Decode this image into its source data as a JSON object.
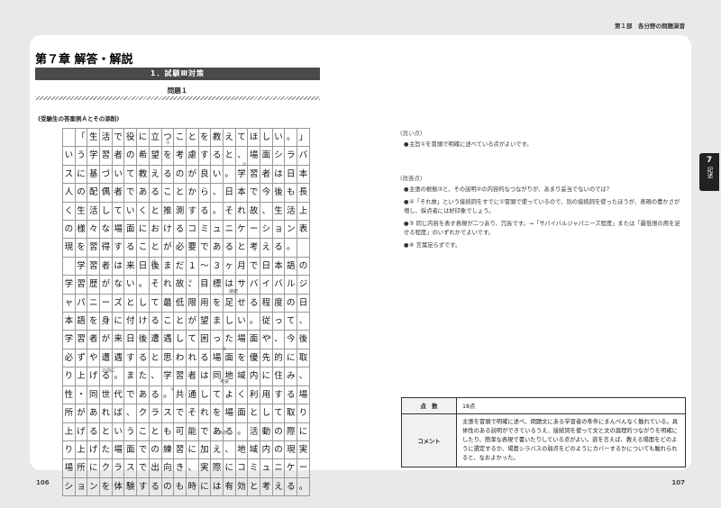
{
  "running_head": "第１部　各分野の問題演習",
  "left_page": {
    "chapter_title": "第７章 解答・解説",
    "section_bar": "1．試験Ⅲ対策",
    "question_title": "問題１",
    "sample_title": "(受験生の答案例Ａとその添削)",
    "grid_rows": [
      " 「生活で役に立つことを教えてほしい。」と",
      "いう学習者の希望を考慮すると、場面シラバ",
      "スに基づいて教えるのが良い。学習者は日本",
      "人の配偶者であることから、日本で今後も長",
      "く生活していくと推測する。それ故、生活上",
      "の様々な場面におけるコミュニケーション表",
      "現を習得することが必要であると考える。",
      " 学習者は来日後まだ１〜３ヶ月で日本語の",
      "学習歴がない。それ故、目標はサバイバルジ",
      "ャパニーズとして最低限用を足せる程度の日",
      "本語を身に付けることが望ましい。従って、",
      "学習者が来日後遭遇して困った場面や、今後",
      "必ずや遭遇すると思われる場面を優先的に取",
      "り上げる。また、学習者は同地域内に住み、同",
      "性・同世代である。共通してよく利用する場",
      "所があれば、クラスでそれを場面として取り",
      "上げるということも可能である。活動の際に取",
      "り上げた場面での練習に加え、地域内の現実の",
      "場所にクラスで出向き、実際にコミュニケー",
      "ションを体験するのも時には有効と考える。"
    ],
    "corrections": [
      "①",
      "②",
      "③",
      "④",
      "接続",
      "⑤",
      "の前に",
      "⑥",
      "考慮",
      "⑦",
      "である"
    ],
    "page_number": "106"
  },
  "right_page": {
    "good_heading": "(良い点)",
    "good_points": [
      "主旨①を冒頭で明確に述べている点がよいです。"
    ],
    "improve_heading": "(改善点)",
    "improve_points": [
      "主張の根拠③と、その説明②の内容的なつながりが、あまり妥当でないのでは？",
      "④「それ故」という接続詞をすでに①冒頭で使っているので、別の接続詞を使ったほうが、表現の豊かさが増し、採点者には好印象でしょう。",
      "⑤ 同じ内容を表す表現が二つあり、冗長です。→「サバイバルジャパニーズ程度」または「最低限の用を足せる程度」のいずれかでよいです。",
      "⑥ 言葉足らずです。"
    ],
    "score_label": "点　数",
    "score_value": "18点",
    "comment_label": "コメント",
    "comment_text": "主張を冒頭で明確に述べ、問題文にある学習者の条件にまんべんなく触れている。具体性のある説明ができているうえ、接続詞を使って文と文の論理的つながりを明確にしたり、簡潔な表現で書いたりしている点がよい。欲を言えば、教える場面をどのように選定するか、場面シラバスの弱点をどのようにカバーするかについても触れられると、なおよかった。",
    "page_number": "107"
  },
  "tab": {
    "number": "7",
    "label": "記述"
  }
}
